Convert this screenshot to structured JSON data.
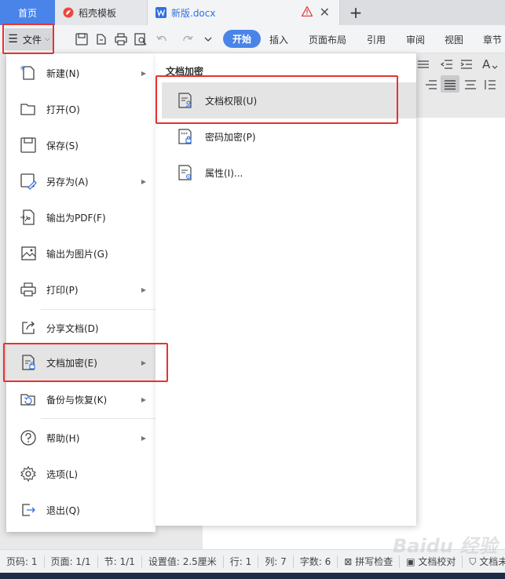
{
  "tabs": {
    "home": "首页",
    "template": "稻壳模板",
    "document": "新版.docx"
  },
  "toolbar": {
    "file_label": "文件",
    "ribbon_tabs": [
      "开始",
      "插入",
      "页面布局",
      "引用",
      "审阅",
      "视图",
      "章节"
    ]
  },
  "file_menu": {
    "items": [
      {
        "label": "新建(N)",
        "icon": "new-doc-icon",
        "has_submenu": true
      },
      {
        "label": "打开(O)",
        "icon": "folder-open-icon",
        "has_submenu": false
      },
      {
        "label": "保存(S)",
        "icon": "save-icon",
        "has_submenu": false
      },
      {
        "label": "另存为(A)",
        "icon": "save-as-icon",
        "has_submenu": true
      },
      {
        "label": "输出为PDF(F)",
        "icon": "pdf-export-icon",
        "has_submenu": false
      },
      {
        "label": "输出为图片(G)",
        "icon": "image-export-icon",
        "has_submenu": false
      },
      {
        "label": "打印(P)",
        "icon": "printer-icon",
        "has_submenu": true
      },
      {
        "label": "分享文档(D)",
        "icon": "share-icon",
        "has_submenu": false
      },
      {
        "label": "文档加密(E)",
        "icon": "doc-encrypt-icon",
        "has_submenu": true
      },
      {
        "label": "备份与恢复(K)",
        "icon": "backup-icon",
        "has_submenu": true
      },
      {
        "label": "帮助(H)",
        "icon": "help-icon",
        "has_submenu": true
      },
      {
        "label": "选项(L)",
        "icon": "gear-icon",
        "has_submenu": false
      },
      {
        "label": "退出(Q)",
        "icon": "exit-icon",
        "has_submenu": false
      }
    ]
  },
  "submenu": {
    "title": "文档加密",
    "items": [
      {
        "label": "文档权限(U)",
        "icon": "doc-permission-icon"
      },
      {
        "label": "密码加密(P)",
        "icon": "password-encrypt-icon"
      },
      {
        "label": "属性(I)...",
        "icon": "properties-icon"
      }
    ]
  },
  "statusbar": {
    "items": [
      "页码: 1",
      "页面: 1/1",
      "节: 1/1",
      "设置值: 2.5厘米",
      "行: 1",
      "列: 7",
      "字数: 6",
      "拼写检查",
      "文档校对",
      "文档未"
    ]
  },
  "watermark": "Baidu 经验",
  "colors": {
    "accent": "#4a84e8",
    "highlight": "#e8312f"
  }
}
